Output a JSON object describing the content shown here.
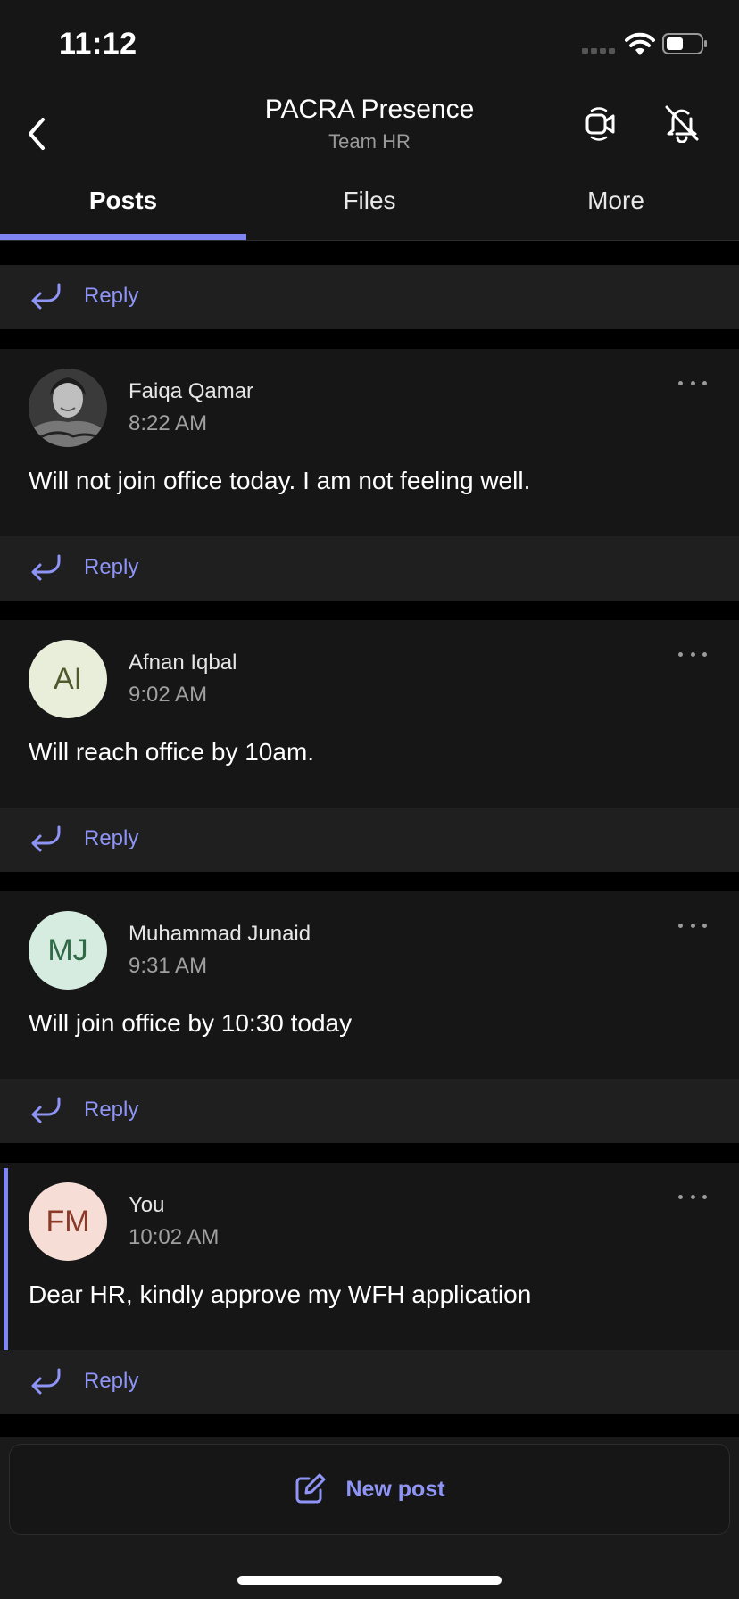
{
  "status_bar": {
    "time": "11:12"
  },
  "header": {
    "title": "PACRA Presence",
    "subtitle": "Team HR"
  },
  "tabs": [
    {
      "label": "Posts",
      "active": true
    },
    {
      "label": "Files",
      "active": false
    },
    {
      "label": "More",
      "active": false
    }
  ],
  "reply_label": "Reply",
  "posts": [
    {
      "author": "Faiqa  Qamar",
      "time": "8:22 AM",
      "message": "Will not join office today. I am not feeling well.",
      "avatar": {
        "type": "photo",
        "initials": ""
      }
    },
    {
      "author": "Afnan Iqbal",
      "time": "9:02 AM",
      "message": "Will reach office by 10am.",
      "avatar": {
        "type": "initials",
        "initials": "AI",
        "bg": "#e9eedb",
        "fg": "#4e5a2e"
      }
    },
    {
      "author": "Muhammad Junaid",
      "time": "9:31 AM",
      "message": "Will join office by 10:30 today",
      "avatar": {
        "type": "initials",
        "initials": "MJ",
        "bg": "#d6ece0",
        "fg": "#2e6a46"
      }
    },
    {
      "author": "You",
      "time": "10:02 AM",
      "message": "Dear HR, kindly approve my WFH application",
      "avatar": {
        "type": "initials",
        "initials": "FM",
        "bg": "#f6ddd6",
        "fg": "#8a3a28"
      }
    }
  ],
  "new_post": {
    "label": "New post"
  },
  "colors": {
    "accent": "#7f85f5",
    "background": "#161616",
    "reply_bar": "#1f1f1f"
  }
}
